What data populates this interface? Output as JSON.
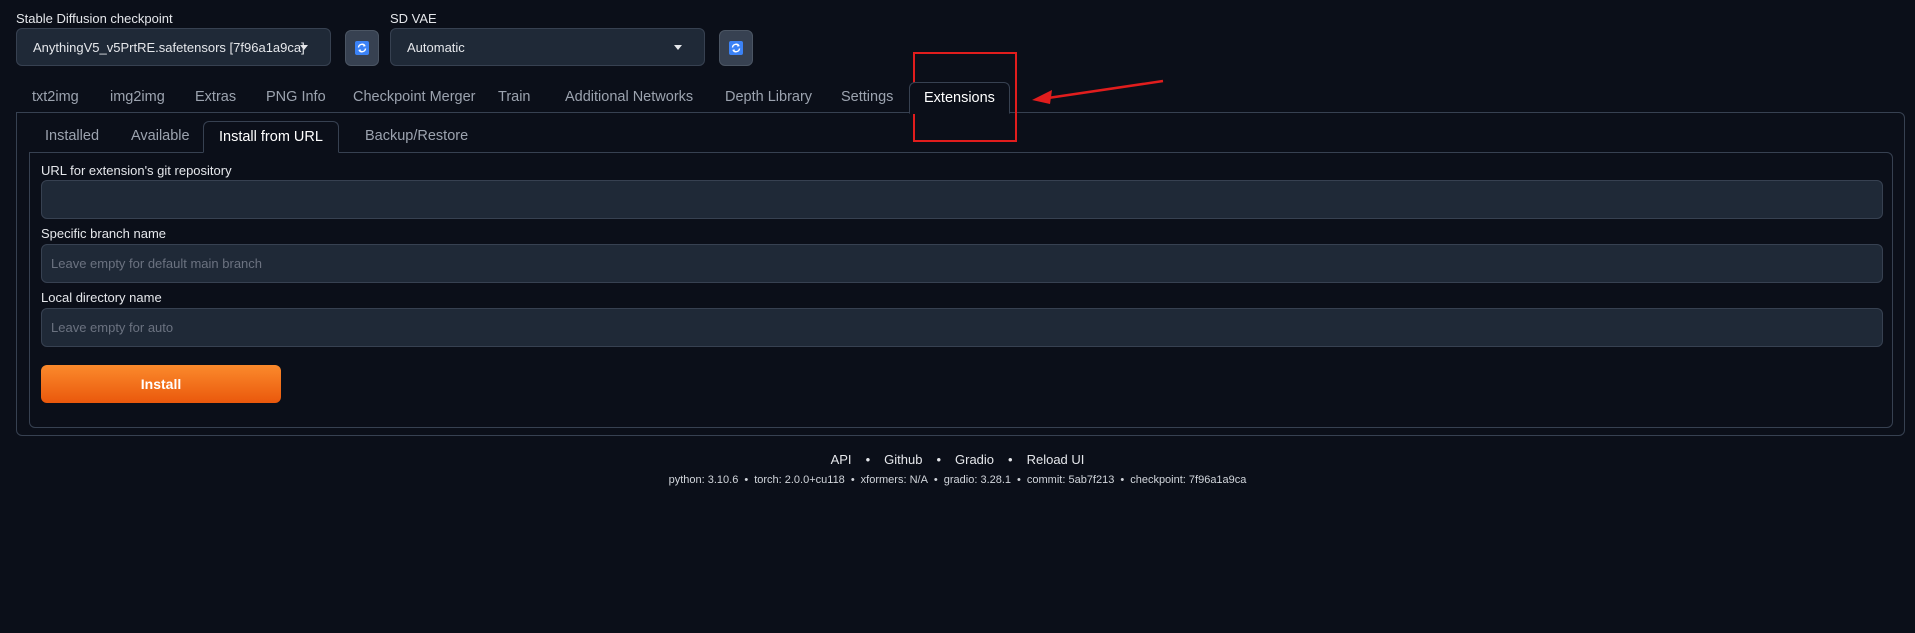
{
  "checkpoint": {
    "label": "Stable Diffusion checkpoint",
    "value": "AnythingV5_v5PrtRE.safetensors [7f96a1a9ca]",
    "refresh_icon": "refresh-icon"
  },
  "vae": {
    "label": "SD VAE",
    "value": "Automatic",
    "refresh_icon": "refresh-icon"
  },
  "main_tabs": [
    {
      "label": "txt2img"
    },
    {
      "label": "img2img"
    },
    {
      "label": "Extras"
    },
    {
      "label": "PNG Info"
    },
    {
      "label": "Checkpoint Merger"
    },
    {
      "label": "Train"
    },
    {
      "label": "Additional Networks"
    },
    {
      "label": "Depth Library"
    },
    {
      "label": "Settings"
    },
    {
      "label": "Extensions",
      "active": true
    }
  ],
  "sub_tabs": [
    {
      "label": "Installed"
    },
    {
      "label": "Available"
    },
    {
      "label": "Install from URL",
      "active": true
    },
    {
      "label": "Backup/Restore"
    }
  ],
  "form": {
    "url_label": "URL for extension's git repository",
    "url_value": "",
    "branch_label": "Specific branch name",
    "branch_placeholder": "Leave empty for default main branch",
    "dir_label": "Local directory name",
    "dir_placeholder": "Leave empty for auto",
    "install_label": "Install"
  },
  "footer": {
    "links": [
      "API",
      "Github",
      "Gradio",
      "Reload UI"
    ],
    "separator": "•",
    "versions": [
      "python: 3.10.6",
      "torch: 2.0.0+cu118",
      "xformers: N/A",
      "gradio: 3.28.1",
      "commit: 5ab7f213",
      "checkpoint: 7f96a1a9ca"
    ]
  },
  "colors": {
    "background": "#0b0f19",
    "accent": "#ea580c",
    "annotation": "#e11d1d",
    "refresh_icon": "#3b82f6"
  }
}
